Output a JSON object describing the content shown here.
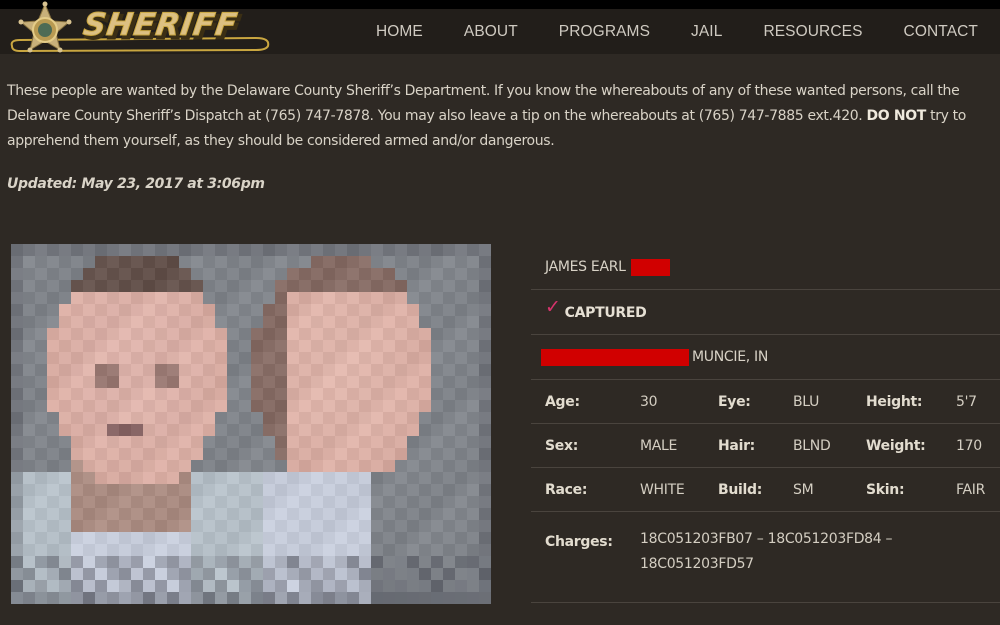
{
  "header": {
    "logo_text": "SHERIFF",
    "nav": [
      "HOME",
      "ABOUT",
      "PROGRAMS",
      "JAIL",
      "RESOURCES",
      "CONTACT"
    ]
  },
  "intro": {
    "text_1": "These people are wanted by the Delaware County Sheriff’s Department.  If you know the whereabouts of any of these wanted persons, call the Delaware County Sheriff’s Dispatch at (765) 747-7878.  You may also leave a tip on the whereabouts at (765) 747-7885 ext.420.  ",
    "bold": "DO NOT",
    "text_2": " try to apprehend them yourself, as they should be considered armed and/or dangerous.",
    "updated": "Updated: May 23, 2017 at 3:06pm"
  },
  "person": {
    "name": "JAMES EARL",
    "status_icon": "checkmark-icon",
    "status": "CAPTURED",
    "city": "MUNCIE, IN",
    "attributes": [
      [
        {
          "label": "Age:",
          "value": "30"
        },
        {
          "label": "Eye:",
          "value": "BLU"
        },
        {
          "label": "Height:",
          "value": "5'7"
        }
      ],
      [
        {
          "label": "Sex:",
          "value": "MALE"
        },
        {
          "label": "Hair:",
          "value": "BLND"
        },
        {
          "label": "Weight:",
          "value": "170"
        }
      ],
      [
        {
          "label": "Race:",
          "value": "WHITE"
        },
        {
          "label": "Build:",
          "value": "SM"
        },
        {
          "label": "Skin:",
          "value": "FAIR"
        }
      ]
    ],
    "charges_label": "Charges:",
    "charges": "18C051203FB07 – 18C051203FD84 – 18C051203FD57"
  },
  "colors": {
    "background": "#2e2924",
    "header": "#221e1a",
    "redaction": "#d10000",
    "check": "#d6336c",
    "logo_gold": "#d8b870"
  }
}
